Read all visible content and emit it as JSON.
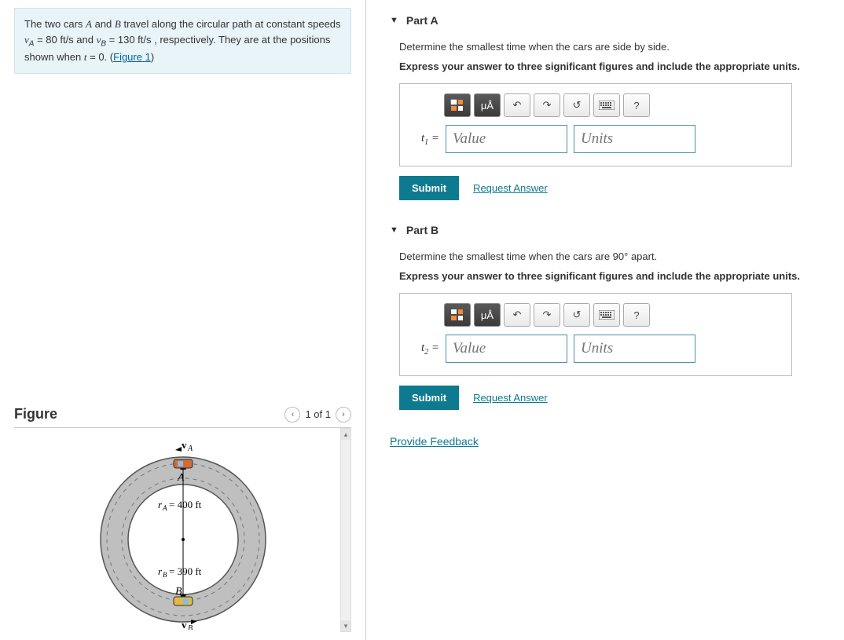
{
  "problem": {
    "pre1": "The two cars ",
    "A": "A",
    "and": " and ",
    "B": "B",
    "pre2": " travel along the circular path at constant speeds ",
    "vA_lhs": "v",
    "vA_sub": "A",
    "vA_eq": " = 80  ft/s",
    "and2": " and ",
    "vB_lhs": "v",
    "vB_sub": "B",
    "vB_eq": " = 130  ft/s",
    "post": " , respectively. They are at the positions shown when ",
    "t_var": "t",
    "t_eq": " = 0. (",
    "fig_link": "Figure 1",
    "close": ")"
  },
  "figure": {
    "title": "Figure",
    "nav": "1 of 1",
    "labels": {
      "vA": "v",
      "vA_sub": "A",
      "A": "A",
      "rA": "r",
      "rA_sub": "A",
      "rA_val": " = 400 ft",
      "rB": "r",
      "rB_sub": "B",
      "rB_val": " = 390 ft",
      "B": "B",
      "vB": "v",
      "vB_sub": "B"
    }
  },
  "partA": {
    "title": "Part A",
    "question": "Determine the smallest time when the cars are side by side.",
    "instruction": "Express your answer to three significant figures and include the appropriate units.",
    "var": "t",
    "sub": "1",
    "eq": " = ",
    "value_ph": "Value",
    "units_ph": "Units",
    "submit": "Submit",
    "request": "Request Answer"
  },
  "partB": {
    "title": "Part B",
    "question_pre": "Determine the smallest time when the cars are ",
    "angle": "90°",
    "question_post": " apart.",
    "instruction": "Express your answer to three significant figures and include the appropriate units.",
    "var": "t",
    "sub": "2",
    "eq": " = ",
    "value_ph": "Value",
    "units_ph": "Units",
    "submit": "Submit",
    "request": "Request Answer"
  },
  "feedback": "Provide Feedback",
  "toolbar": {
    "units_label": "μÅ",
    "help": "?"
  }
}
